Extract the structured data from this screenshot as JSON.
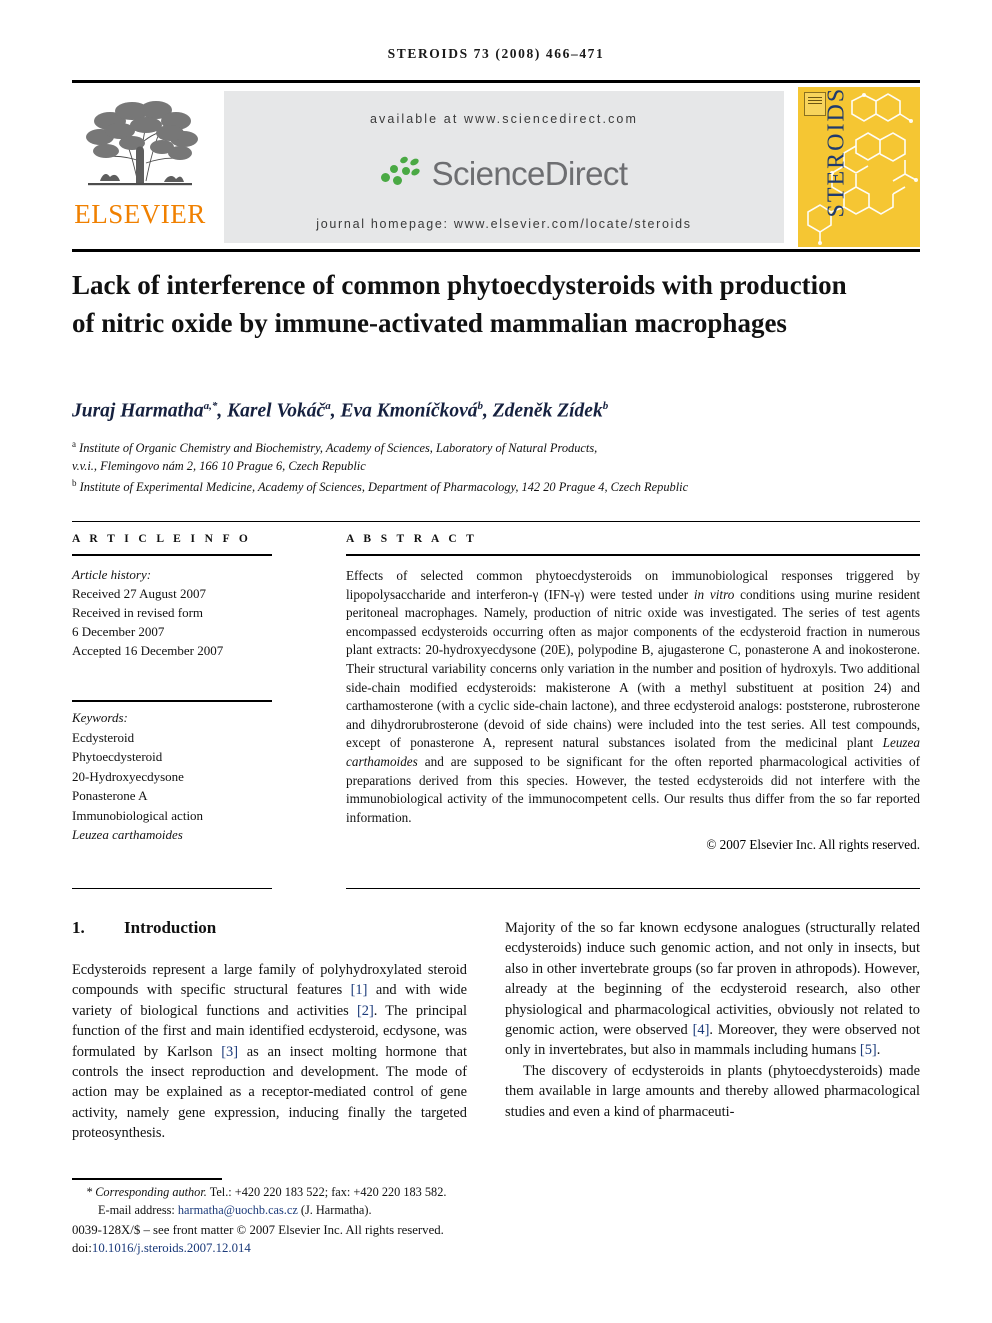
{
  "running_head": "STEROIDS 73 (2008) 466–471",
  "masthead": {
    "publisher_name": "ELSEVIER",
    "publisher_logo_icon": "elsevier-tree-icon",
    "available_at": "available at www.sciencedirect.com",
    "sciencedirect_wordmark": "ScienceDirect",
    "sciencedirect_logo_icon": "sciencedirect-leaves-icon",
    "journal_homepage": "journal homepage: www.elsevier.com/locate/steroids",
    "cover_journal_title": "STEROIDS",
    "cover_badge_icon": "elsevier-seal-icon",
    "colors": {
      "panel_background": "#e6e7e8",
      "elsevier_orange": "#f08000",
      "sciencedirect_green": "#4aa944",
      "sciencedirect_gray": "#6d6e71",
      "cover_yellow": "#f5c633",
      "cover_blue": "#1f3a6e"
    }
  },
  "article": {
    "title": "Lack of interference of common phytoecdysteroids with production of nitric oxide by immune-activated mammalian macrophages",
    "authors": "Juraj Harmatha a,*, Karel Vokáč a, Eva Kmoníčková b, Zdeněk Zídek b",
    "author_list": [
      {
        "name": "Juraj Harmatha",
        "marks": "a,*"
      },
      {
        "name": "Karel Vokáč",
        "marks": "a"
      },
      {
        "name": "Eva Kmoníčková",
        "marks": "b"
      },
      {
        "name": "Zdeněk Zídek",
        "marks": "b"
      }
    ],
    "affiliations": [
      {
        "mark": "a",
        "text": "Institute of Organic Chemistry and Biochemistry, Academy of Sciences, Laboratory of Natural Products,"
      },
      {
        "mark": "",
        "text": "v.v.i., Flemingovo nám 2, 166 10 Prague 6, Czech Republic"
      },
      {
        "mark": "b",
        "text": "Institute of Experimental Medicine, Academy of Sciences, Department of Pharmacology, 142 20 Prague 4, Czech Republic"
      }
    ]
  },
  "article_info": {
    "heading": "A R T I C L E   I N F O",
    "history_label": "Article history:",
    "history_lines": [
      "Received 27 August 2007",
      "Received in revised form",
      "6 December 2007",
      "Accepted 16 December 2007"
    ],
    "keywords_label": "Keywords:",
    "keywords": [
      "Ecdysteroid",
      "Phytoecdysteroid",
      "20-Hydroxyecdysone",
      "Ponasterone A",
      "Immunobiological action",
      "Leuzea carthamoides"
    ]
  },
  "abstract": {
    "heading": "A B S T R A C T",
    "text_part_1": "Effects of selected common phytoecdysteroids on immunobiological responses triggered by lipopolysaccharide and interferon-γ (IFN-γ) were tested under ",
    "text_in_vitro": "in vitro",
    "text_part_2": " conditions using murine resident peritoneal macrophages. Namely, production of nitric oxide was investigated. The series of test agents encompassed ecdysteroids occurring often as major components of the ecdysteroid fraction in numerous plant extracts: 20-hydroxyecdysone (20E), polypodine B, ajugasterone C, ponasterone A and inokosterone. Their structural variability concerns only variation in the number and position of hydroxyls. Two additional side-chain modified ecdysteroids: makisterone A (with a methyl substituent at position 24) and carthamosterone (with a cyclic side-chain lactone), and three ecdysteroid analogs: poststerone, rubrosterone and dihydrorubrosterone (devoid of side chains) were included into the test series. All test compounds, except of ponasterone A, represent natural substances isolated from the medicinal plant ",
    "text_leuzea": "Leuzea carthamoides",
    "text_part_3": " and are supposed to be significant for the often reported pharmacological activities of preparations derived from this species. However, the tested ecdysteroids did not interfere with the immunobiological activity of the immunocompetent cells. Our results thus differ from the so far reported information.",
    "copyright": "© 2007 Elsevier Inc. All rights reserved."
  },
  "body": {
    "section_number": "1.",
    "section_title": "Introduction",
    "left_paragraph_1_a": "Ecdysteroids represent a large family of polyhydroxylated steroid compounds with specific structural features ",
    "left_ref_1": "[1]",
    "left_paragraph_1_b": " and with wide variety of biological functions and activities ",
    "left_ref_2": "[2]",
    "left_paragraph_1_c": ". The principal function of the first and main identified ecdysteroid, ecdysone, was formulated by Karlson ",
    "left_ref_3": "[3]",
    "left_paragraph_1_d": " as an insect molting hormone that controls the insect reproduction and development. The mode of action may be explained as a receptor-mediated control of gene activity, namely gene expression, inducing finally the targeted proteosynthesis.",
    "right_paragraph_1_a": "Majority of the so far known ecdysone analogues (structurally related ecdysteroids) induce such genomic action, and not only in insects, but also in other invertebrate groups (so far proven in athropods). However, already at the beginning of the ecdysteroid research, also other physiological and pharmacological activities, obviously not related to genomic action, were observed ",
    "right_ref_4": "[4]",
    "right_paragraph_1_b": ". Moreover, they were observed not only in invertebrates, but also in mammals including humans ",
    "right_ref_5": "[5]",
    "right_paragraph_1_c": ".",
    "right_paragraph_2": "The discovery of ecdysteroids in plants (phytoecdysteroids) made them available in large amounts and thereby allowed pharmacological studies and even a kind of pharmaceuti-"
  },
  "footer": {
    "corresponding_mark": "*",
    "corresponding_label": "Corresponding author.",
    "corresponding_contact": " Tel.: +420 220 183 522; fax: +420 220 183 582.",
    "email_label": "E-mail address: ",
    "email": "harmatha@uochb.cas.cz",
    "email_suffix": " (J. Harmatha).",
    "issn_line": "0039-128X/$ – see front matter © 2007 Elsevier Inc. All rights reserved.",
    "doi_label": "doi:",
    "doi": "10.1016/j.steroids.2007.12.014"
  }
}
